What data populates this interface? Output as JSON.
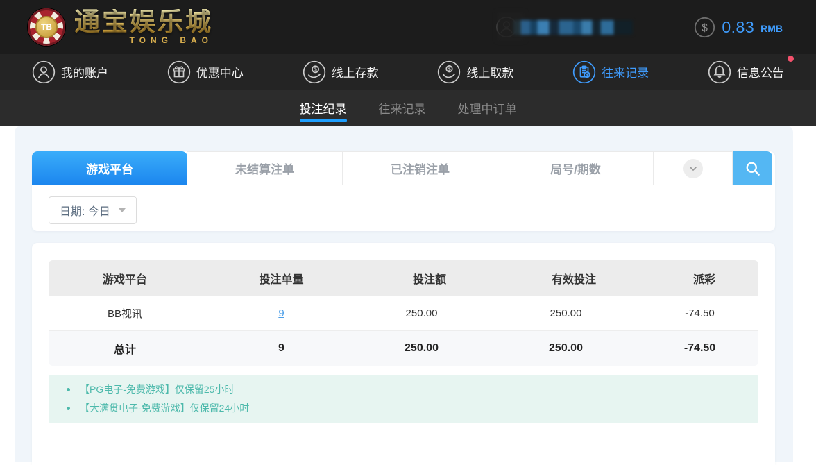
{
  "header": {
    "brand": {
      "chip_text": "TB",
      "name_cn": "通宝娱乐城",
      "name_en": "TONG BAO"
    },
    "balance": {
      "amount": "0.83",
      "currency": "RMB"
    }
  },
  "nav": {
    "items": [
      {
        "label": "我的账户",
        "icon": "user-account-icon",
        "active": false
      },
      {
        "label": "优惠中心",
        "icon": "promotions-gift-icon",
        "active": false
      },
      {
        "label": "线上存款",
        "icon": "online-deposit-icon",
        "active": false
      },
      {
        "label": "线上取款",
        "icon": "online-withdraw-icon",
        "active": false
      },
      {
        "label": "往来记录",
        "icon": "transaction-records-icon",
        "active": true
      },
      {
        "label": "信息公告",
        "icon": "announcement-bell-icon",
        "active": false,
        "has_notification_dot": true
      }
    ]
  },
  "subnav": {
    "tabs": [
      {
        "label": "投注纪录",
        "active": true
      },
      {
        "label": "往来记录",
        "active": false
      },
      {
        "label": "处理中订单",
        "active": false
      }
    ]
  },
  "filters": {
    "tabs": [
      {
        "label": "游戏平台",
        "active": true
      },
      {
        "label": "未结算注单",
        "active": false
      },
      {
        "label": "已注销注单",
        "active": false
      },
      {
        "label": "局号/期数",
        "active": false
      }
    ],
    "expand_icon": "chevron-down-icon",
    "search_icon": "search-icon",
    "date_filter_label": "日期: 今日"
  },
  "table": {
    "columns": [
      "游戏平台",
      "投注单量",
      "投注额",
      "有效投注",
      "派彩"
    ],
    "rows": [
      {
        "platform": "BB视讯",
        "bet_count": "9",
        "bet_amount": "250.00",
        "valid_bet": "250.00",
        "payout": "-74.50"
      }
    ],
    "total": {
      "label": "总计",
      "bet_count": "9",
      "bet_amount": "250.00",
      "valid_bet": "250.00",
      "payout": "-74.50"
    }
  },
  "notes": [
    "【PG电子-免费游戏】仅保留25小时",
    "【大满贯电子-免费游戏】仅保留24小时"
  ],
  "colors": {
    "accent_blue": "#3f9bfc",
    "active_tab_gradient_top": "#3aadfa",
    "active_tab_gradient_bottom": "#1b85ee",
    "search_button_blue": "#54b7f3",
    "subnav_underline_blue": "#1e9fff",
    "negative_red": "#f4516c",
    "notification_dot_red": "#f4516c",
    "note_teal_text": "#4cb9ab",
    "note_teal_bg": "#e7f5f1",
    "brand_gold": "#e0b44e"
  }
}
